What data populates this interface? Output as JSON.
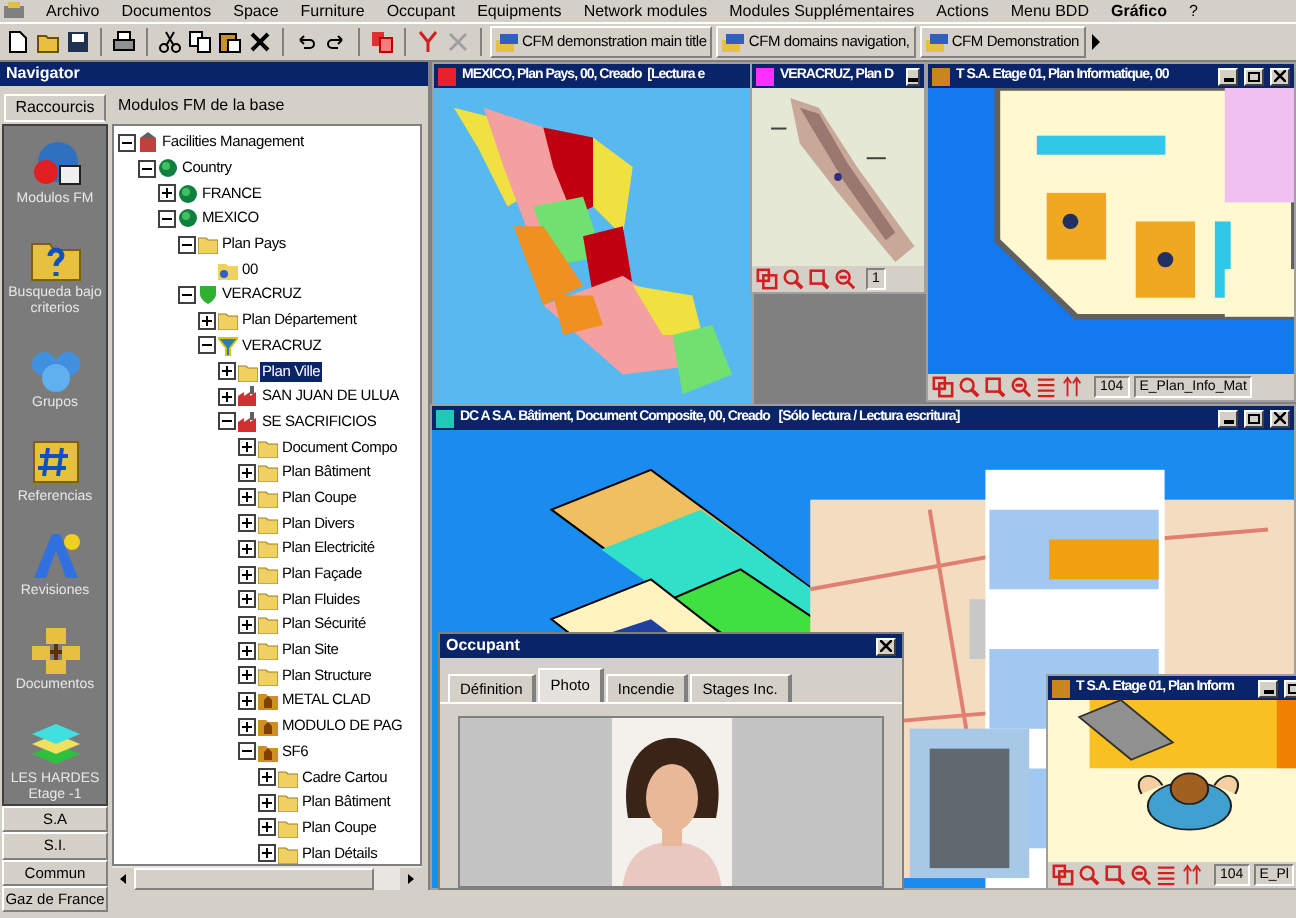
{
  "menu": [
    {
      "label": "Archivo",
      "bold": false
    },
    {
      "label": "Documentos",
      "bold": false
    },
    {
      "label": "Space",
      "bold": false
    },
    {
      "label": "Furniture",
      "bold": false
    },
    {
      "label": "Occupant",
      "bold": false
    },
    {
      "label": "Equipments",
      "bold": false
    },
    {
      "label": "Network modules",
      "bold": false
    },
    {
      "label": "Modules Supplémentaires",
      "bold": false
    },
    {
      "label": "Actions",
      "bold": false
    },
    {
      "label": "Menu BDD",
      "bold": false
    },
    {
      "label": "Gráfico",
      "bold": true
    },
    {
      "label": "?",
      "bold": false
    }
  ],
  "toolbar": {
    "shortcuts": [
      "CFM demonstration main title",
      "CFM domains navigation,",
      "CFM Demonstration"
    ]
  },
  "navigator": {
    "title": "Navigator",
    "tab": "Raccourcis",
    "header": "Modulos FM de la base",
    "shortcuts": [
      {
        "label": "Modulos FM",
        "kind": "modules"
      },
      {
        "label": "Busqueda bajo criterios",
        "kind": "search"
      },
      {
        "label": "Grupos",
        "kind": "groups"
      },
      {
        "label": "Referencias",
        "kind": "references"
      },
      {
        "label": "Revisiones",
        "kind": "revisions"
      },
      {
        "label": "Documentos",
        "kind": "documents"
      },
      {
        "label": "LES HARDES Etage -1",
        "kind": "layers"
      }
    ],
    "groups": [
      "S.A",
      "S.I.",
      "Commun",
      "Gaz de France"
    ],
    "tree": [
      {
        "label": "Facilities Management",
        "kind": "root",
        "expanded": true,
        "selected": false,
        "children": [
          {
            "label": "Country",
            "kind": "globe",
            "expanded": true,
            "selected": false,
            "children": [
              {
                "label": "FRANCE",
                "kind": "globe",
                "expanded": false,
                "selected": false
              },
              {
                "label": "MEXICO",
                "kind": "globe",
                "expanded": true,
                "selected": false,
                "children": [
                  {
                    "label": "Plan Pays",
                    "kind": "plan",
                    "expanded": true,
                    "selected": false,
                    "children": [
                      {
                        "label": "00",
                        "kind": "version",
                        "selected": false
                      }
                    ]
                  },
                  {
                    "label": "VERACRUZ",
                    "kind": "region",
                    "expanded": true,
                    "selected": false,
                    "children": [
                      {
                        "label": "Plan Département",
                        "kind": "plan",
                        "expanded": false,
                        "selected": false
                      },
                      {
                        "label": "VERACRUZ",
                        "kind": "city",
                        "expanded": true,
                        "selected": false,
                        "children": [
                          {
                            "label": "Plan Ville",
                            "kind": "plan",
                            "expanded": false,
                            "selected": true
                          },
                          {
                            "label": "SAN JUAN DE ULUA",
                            "kind": "site",
                            "expanded": false,
                            "selected": false
                          },
                          {
                            "label": "SE SACRIFICIOS",
                            "kind": "site",
                            "expanded": true,
                            "selected": false,
                            "children": [
                              {
                                "label": "Document Compo",
                                "kind": "plan",
                                "expanded": false,
                                "selected": false
                              },
                              {
                                "label": "Plan Bâtiment",
                                "kind": "plan",
                                "expanded": false,
                                "selected": false
                              },
                              {
                                "label": "Plan Coupe",
                                "kind": "plan",
                                "expanded": false,
                                "selected": false
                              },
                              {
                                "label": "Plan Divers",
                                "kind": "plan",
                                "expanded": false,
                                "selected": false
                              },
                              {
                                "label": "Plan Electricité",
                                "kind": "plan",
                                "expanded": false,
                                "selected": false
                              },
                              {
                                "label": "Plan Façade",
                                "kind": "plan",
                                "expanded": false,
                                "selected": false
                              },
                              {
                                "label": "Plan Fluides",
                                "kind": "plan",
                                "expanded": false,
                                "selected": false
                              },
                              {
                                "label": "Plan Sécurité",
                                "kind": "plan",
                                "expanded": false,
                                "selected": false
                              },
                              {
                                "label": "Plan Site",
                                "kind": "plan",
                                "expanded": false,
                                "selected": false
                              },
                              {
                                "label": "Plan Structure",
                                "kind": "plan",
                                "expanded": false,
                                "selected": false
                              },
                              {
                                "label": "METAL CLAD",
                                "kind": "building",
                                "expanded": false,
                                "selected": false
                              },
                              {
                                "label": "MODULO DE PAG",
                                "kind": "building",
                                "expanded": false,
                                "selected": false
                              },
                              {
                                "label": "SF6",
                                "kind": "building",
                                "expanded": true,
                                "selected": false,
                                "children": [
                                  {
                                    "label": "Cadre Cartou",
                                    "kind": "plan",
                                    "expanded": false,
                                    "selected": false
                                  },
                                  {
                                    "label": "Plan Bâtiment",
                                    "kind": "plan",
                                    "expanded": false,
                                    "selected": false
                                  },
                                  {
                                    "label": "Plan Coupe",
                                    "kind": "plan",
                                    "expanded": false,
                                    "selected": false
                                  },
                                  {
                                    "label": "Plan Détails",
                                    "kind": "plan",
                                    "expanded": false,
                                    "selected": false
                                  }
                                ]
                              }
                            ]
                          }
                        ]
                      }
                    ]
                  }
                ]
              }
            ]
          }
        ]
      }
    ]
  },
  "windows": [
    {
      "title": "MEXICO, Plan Pays, 00, Creado  [Lectura e",
      "color": "#e8202c",
      "kind": "country-map",
      "minimize": false,
      "maximize": false,
      "close": false
    },
    {
      "title": "VERACRUZ, Plan D",
      "color": "#ff30ff",
      "kind": "region-map",
      "minimize": true,
      "maximize": false,
      "close": false,
      "toolbar": {
        "code": "1"
      }
    },
    {
      "title": "T S.A. Etage 01, Plan Informatique, 00",
      "color": "#c8861c",
      "kind": "floor-plan",
      "minimize": true,
      "maximize": true,
      "close": true,
      "toolbar": {
        "code": "104",
        "layer": "E_Plan_Info_Mat"
      }
    },
    {
      "title": "DC A S.A. Bâtiment, Document Composite, 00, Creado   [Sólo lectura / Lectura escritura]",
      "color": "#20c8b8",
      "kind": "composite",
      "minimize": true,
      "maximize": true,
      "close": true
    },
    {
      "title": "T S.A. Etage 01, Plan Inform",
      "color": "#c8861c",
      "kind": "desk",
      "minimize": true,
      "maximize": true,
      "close": false,
      "toolbar": {
        "code": "104",
        "layer": "E_Pl"
      }
    }
  ],
  "occupant": {
    "title": "Occupant",
    "tabs": [
      {
        "label": "Définition",
        "selected": false
      },
      {
        "label": "Photo",
        "selected": true
      },
      {
        "label": "Incendie",
        "selected": false
      },
      {
        "label": "Stages Inc.",
        "selected": false
      }
    ]
  }
}
